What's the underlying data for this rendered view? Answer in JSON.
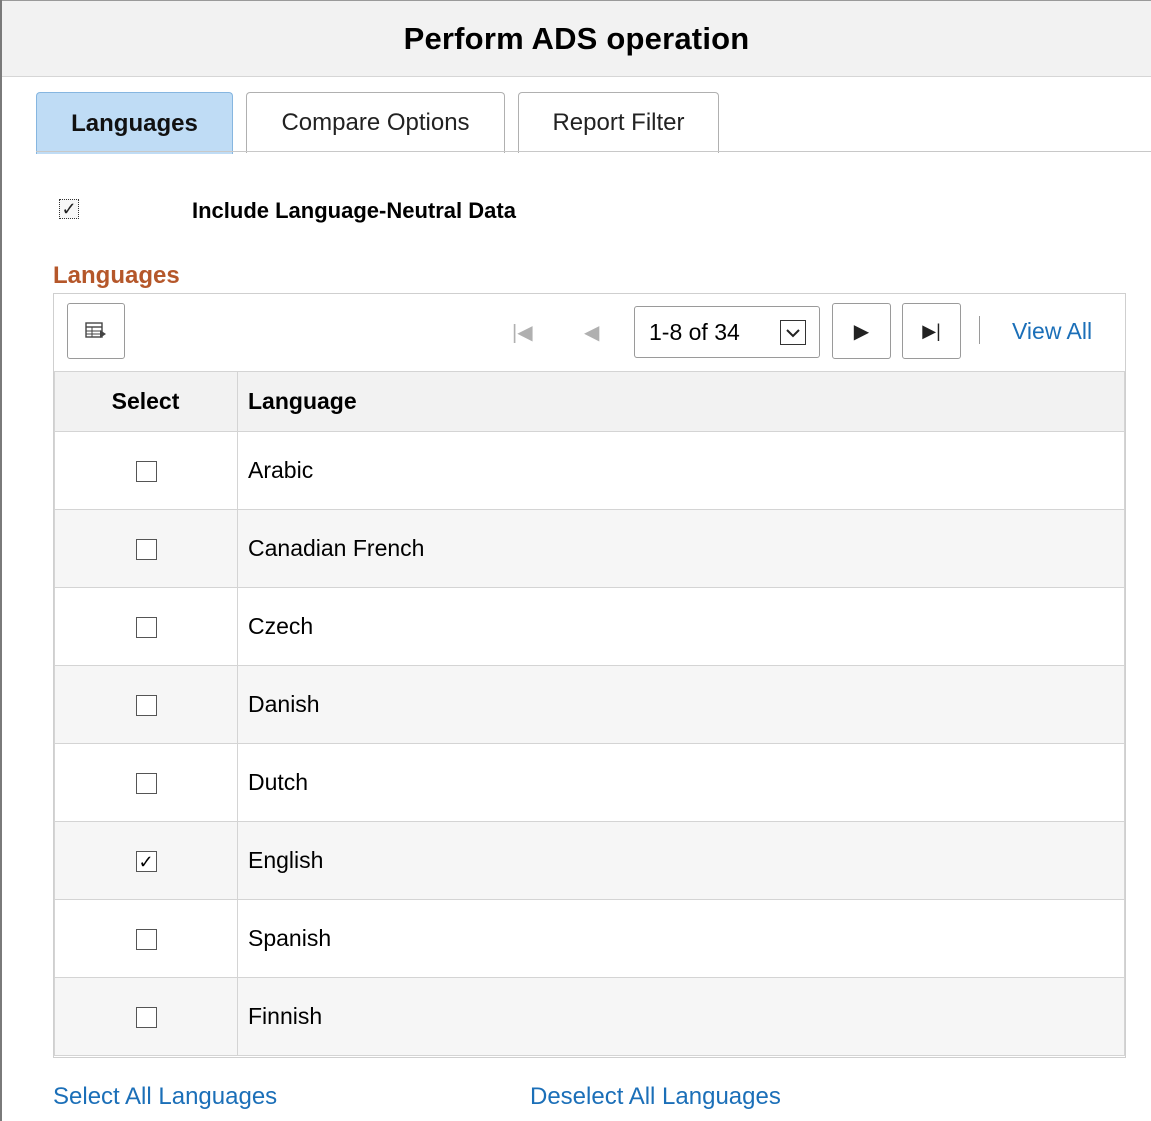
{
  "header": {
    "title": "Perform ADS operation"
  },
  "tabs": [
    {
      "label": "Languages",
      "active": true
    },
    {
      "label": "Compare Options",
      "active": false
    },
    {
      "label": "Report Filter",
      "active": false
    }
  ],
  "neutral": {
    "label": "Include Language-Neutral Data",
    "checked": true
  },
  "section": {
    "title": "Languages"
  },
  "grid": {
    "pagination": {
      "range": "1-8 of 34",
      "view_all": "View All"
    },
    "columns": {
      "select": "Select",
      "language": "Language"
    },
    "rows": [
      {
        "language": "Arabic",
        "checked": false
      },
      {
        "language": "Canadian French",
        "checked": false
      },
      {
        "language": "Czech",
        "checked": false
      },
      {
        "language": "Danish",
        "checked": false
      },
      {
        "language": "Dutch",
        "checked": false
      },
      {
        "language": "English",
        "checked": true
      },
      {
        "language": "Spanish",
        "checked": false
      },
      {
        "language": "Finnish",
        "checked": false
      }
    ]
  },
  "links": {
    "select_all": "Select All Languages",
    "deselect_all": "Deselect All Languages"
  },
  "colors": {
    "tab_active_bg": "#bfdcf5",
    "section_title": "#b5572a",
    "link": "#1b6fb8"
  },
  "icons": {
    "personalize": "grid-personalize-icon",
    "first": "first-page-icon",
    "prev": "previous-page-icon",
    "next": "next-page-icon",
    "last": "last-page-icon",
    "dropdown": "chevron-down-icon",
    "check": "checkmark-icon"
  }
}
